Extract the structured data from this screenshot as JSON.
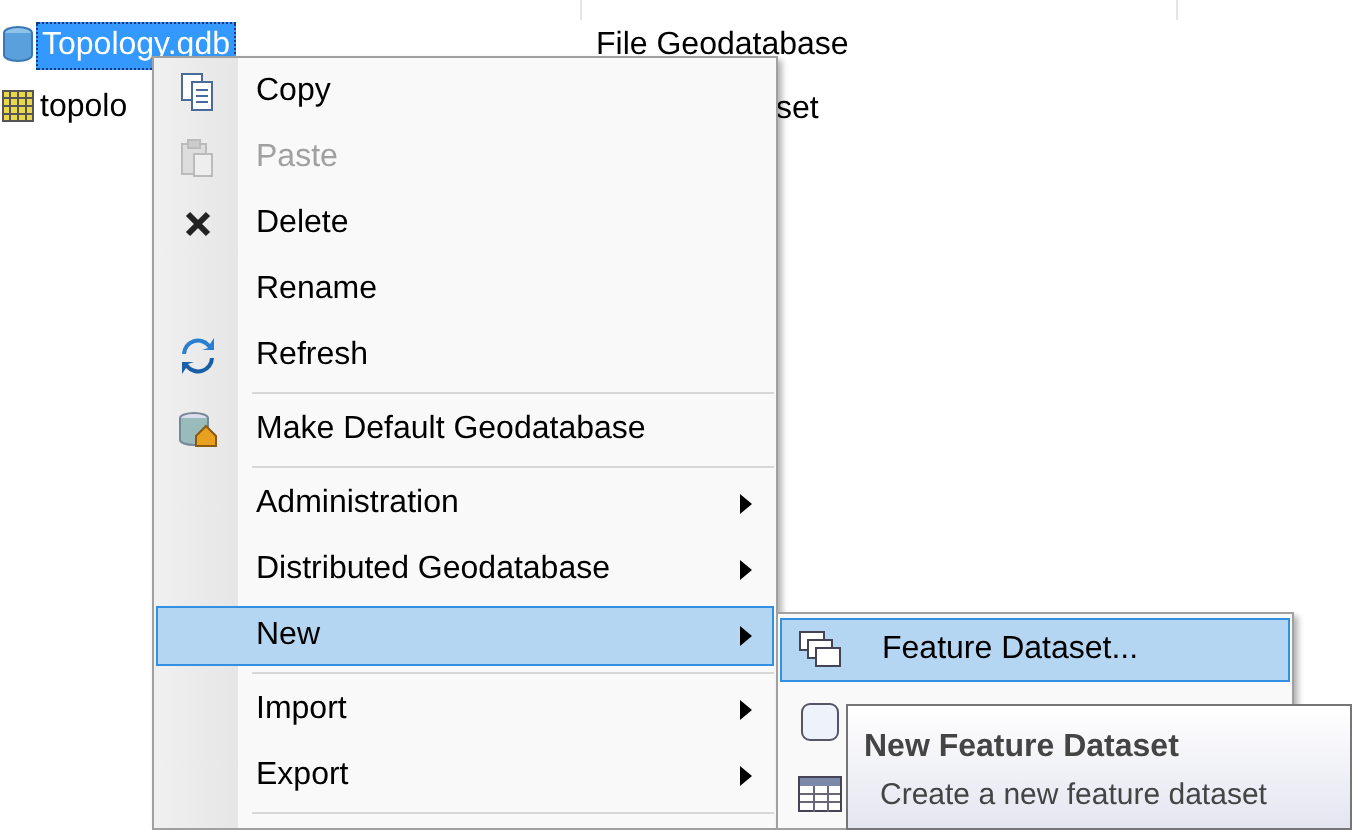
{
  "tree": [
    {
      "name": "Topology.gdb",
      "type": "File Geodatabase",
      "kind": "geodatabase",
      "selected": true
    },
    {
      "name": "topolo",
      "type": "set",
      "kind": "raster",
      "selected": false
    }
  ],
  "context_menu": [
    {
      "label": "Copy",
      "kind": "copy",
      "disabled": false,
      "submenu": false,
      "selected": false,
      "separator_after": false
    },
    {
      "label": "Paste",
      "kind": "paste",
      "disabled": true,
      "submenu": false,
      "selected": false,
      "separator_after": false
    },
    {
      "label": "Delete",
      "kind": "delete",
      "disabled": false,
      "submenu": false,
      "selected": false,
      "separator_after": false
    },
    {
      "label": "Rename",
      "kind": "plain",
      "disabled": false,
      "submenu": false,
      "selected": false,
      "separator_after": false
    },
    {
      "label": "Refresh",
      "kind": "refresh",
      "disabled": false,
      "submenu": false,
      "selected": false,
      "separator_after": true
    },
    {
      "label": "Make Default Geodatabase",
      "kind": "default",
      "disabled": false,
      "submenu": false,
      "selected": false,
      "separator_after": true
    },
    {
      "label": "Administration",
      "kind": "plain",
      "disabled": false,
      "submenu": true,
      "selected": false,
      "separator_after": false
    },
    {
      "label": "Distributed Geodatabase",
      "kind": "plain",
      "disabled": false,
      "submenu": true,
      "selected": false,
      "separator_after": false
    },
    {
      "label": "New",
      "kind": "plain",
      "disabled": false,
      "submenu": true,
      "selected": true,
      "separator_after": true
    },
    {
      "label": "Import",
      "kind": "plain",
      "disabled": false,
      "submenu": true,
      "selected": false,
      "separator_after": false
    },
    {
      "label": "Export",
      "kind": "plain",
      "disabled": false,
      "submenu": true,
      "selected": false,
      "separator_after": true
    }
  ],
  "submenu": [
    {
      "label": "Feature Dataset...",
      "kind": "dataset",
      "selected": true
    },
    {
      "kind": "feature-class"
    },
    {
      "kind": "table"
    }
  ],
  "tooltip": {
    "title": "New Feature Dataset",
    "text": "Create a new feature dataset"
  }
}
